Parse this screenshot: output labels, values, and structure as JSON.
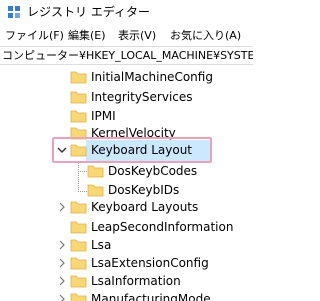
{
  "window": {
    "title": "レジストリ エディター"
  },
  "menu": {
    "file": "ファイル(F)",
    "edit": "編集(E)",
    "view": "表示(V)",
    "favorites": "お気に入り(A)"
  },
  "address": {
    "path": "コンピューター¥HKEY_LOCAL_MACHINE¥SYSTEM¥C"
  },
  "tree": {
    "items": [
      {
        "label": "InitialMachineConfig"
      },
      {
        "label": "IntegrityServices"
      },
      {
        "label": "IPMI"
      },
      {
        "label": "KernelVelocity"
      },
      {
        "label": "Keyboard Layout",
        "expanded": true,
        "selected": true
      },
      {
        "label": "DosKeybCodes"
      },
      {
        "label": "DosKeybIDs"
      },
      {
        "label": "Keyboard Layouts"
      },
      {
        "label": "LeapSecondInformation"
      },
      {
        "label": "Lsa"
      },
      {
        "label": "LsaExtensionConfig"
      },
      {
        "label": "LsaInformation"
      },
      {
        "label": "ManufacturingMode"
      }
    ]
  },
  "colors": {
    "selection": "#cce8ff",
    "highlight_border": "#e8a3b8",
    "folder_fill": "#f8d775",
    "folder_dark": "#e0b04a"
  }
}
